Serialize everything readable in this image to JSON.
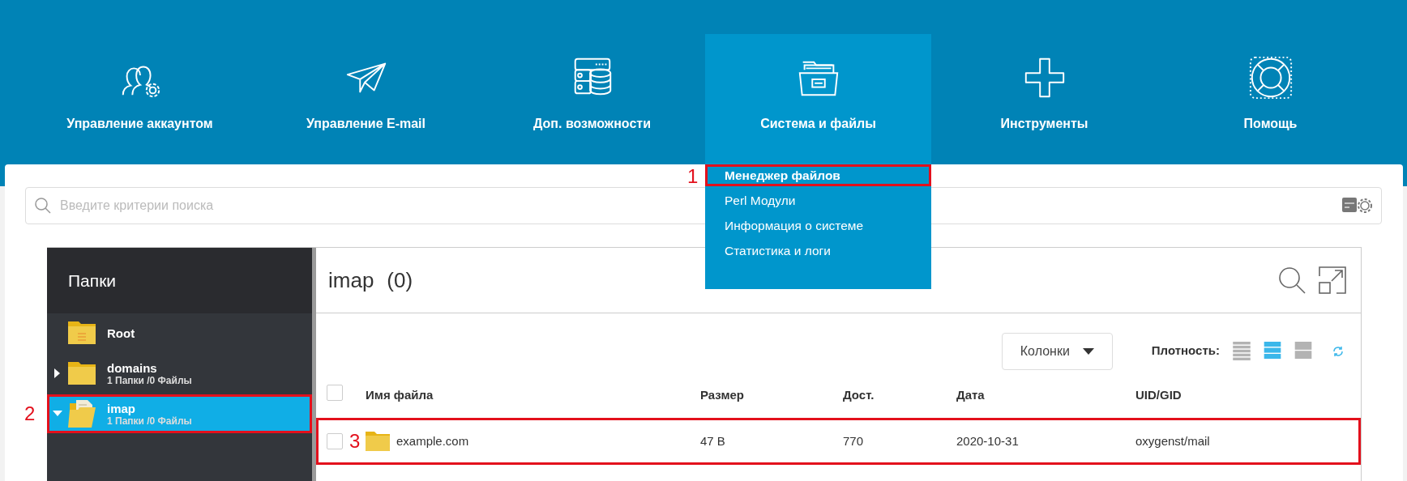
{
  "nav": [
    {
      "label": "Управление аккаунтом",
      "kind": "account",
      "selected": false
    },
    {
      "label": "Управление E-mail",
      "kind": "email",
      "selected": false
    },
    {
      "label": "Доп. возможности",
      "kind": "features",
      "selected": false
    },
    {
      "label": "Система и файлы",
      "kind": "system",
      "selected": true
    },
    {
      "label": "Инструменты",
      "kind": "tools",
      "selected": false
    },
    {
      "label": "Помощь",
      "kind": "help",
      "selected": false
    }
  ],
  "dropdown": [
    {
      "label": "Менеджер файлов",
      "selected": true,
      "callout": "1"
    },
    {
      "label": "Perl Модули",
      "selected": false
    },
    {
      "label": "Информация о системе",
      "selected": false
    },
    {
      "label": "Статистика и логи",
      "selected": false
    }
  ],
  "search": {
    "placeholder": "Введите критерии поиска"
  },
  "sidebar": {
    "title": "Папки",
    "folders": [
      {
        "name": "Root",
        "kind": "root",
        "selected": false
      },
      {
        "name": "domains",
        "kind": "folder",
        "info": "1 Папки /0 Файлы",
        "expanded": false,
        "selected": false
      },
      {
        "name": "imap",
        "kind": "folder",
        "info": "1 Папки /0 Файлы",
        "expanded": true,
        "selected": true,
        "callout": "2"
      }
    ]
  },
  "pane": {
    "name": "imap",
    "count": "(0)"
  },
  "toolbar": {
    "columns_button": "Колонки",
    "density_label": "Плотность:",
    "density": [
      {
        "kind": "compact",
        "selected": false
      },
      {
        "kind": "normal",
        "selected": true
      },
      {
        "kind": "comfortable",
        "selected": false
      }
    ]
  },
  "table": {
    "header_checked": false,
    "columns": [
      "Имя файла",
      "Размер",
      "Дост.",
      "Дата",
      "UID/GID"
    ],
    "rows": [
      {
        "checked": false,
        "callout": "3",
        "cells": [
          "example.com",
          "47 B",
          "770",
          "2020-10-31",
          "oxygenst/mail"
        ]
      }
    ]
  }
}
